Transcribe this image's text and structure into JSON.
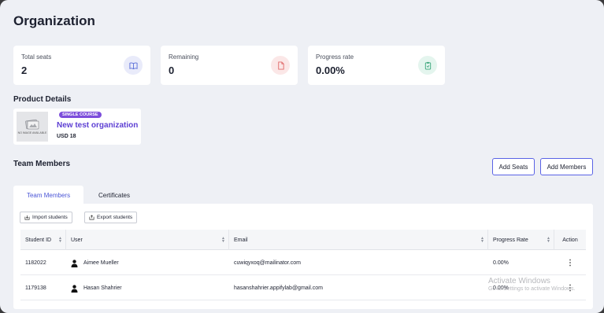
{
  "page": {
    "title": "Organization"
  },
  "stats": [
    {
      "label": "Total seats",
      "value": "2",
      "icon": "book-icon",
      "icon_color": "#5a6fd8",
      "icon_bg": "#e9ebfa"
    },
    {
      "label": "Remaining",
      "value": "0",
      "icon": "document-icon",
      "icon_color": "#e06a6a",
      "icon_bg": "#fbe7e7"
    },
    {
      "label": "Progress rate",
      "value": "0.00%",
      "icon": "clipboard-icon",
      "icon_color": "#3aa57a",
      "icon_bg": "#e4f5ee"
    }
  ],
  "product_details": {
    "heading": "Product Details",
    "thumb_text": "NO IMAGE AVAILABLE",
    "badge": "SINGLE COURSE",
    "name": "New test organization",
    "price": "USD 18"
  },
  "team": {
    "heading": "Team Members",
    "add_seats_label": "Add Seats",
    "add_members_label": "Add Members"
  },
  "tabs": [
    {
      "label": "Team Members",
      "active": true
    },
    {
      "label": "Certificates",
      "active": false
    }
  ],
  "toolbar": {
    "import_label": "Import students",
    "export_label": "Export students"
  },
  "table": {
    "columns": [
      "Student ID",
      "User",
      "Email",
      "Progress Rate",
      "Action"
    ],
    "rows": [
      {
        "id": "1182022",
        "user": "Aimee Mueller",
        "email": "cuwiqyxoq@mailinator.com",
        "progress": "0.00%",
        "action": "⋮"
      },
      {
        "id": "1179138",
        "user": "Hasan Shahrier",
        "email": "hasanshahrier.appifylab@gmail.com",
        "progress": "0.00%",
        "action": "⋮"
      }
    ]
  },
  "watermark": {
    "line1": "Activate Windows",
    "line2": "Go to Settings to activate Windows."
  }
}
